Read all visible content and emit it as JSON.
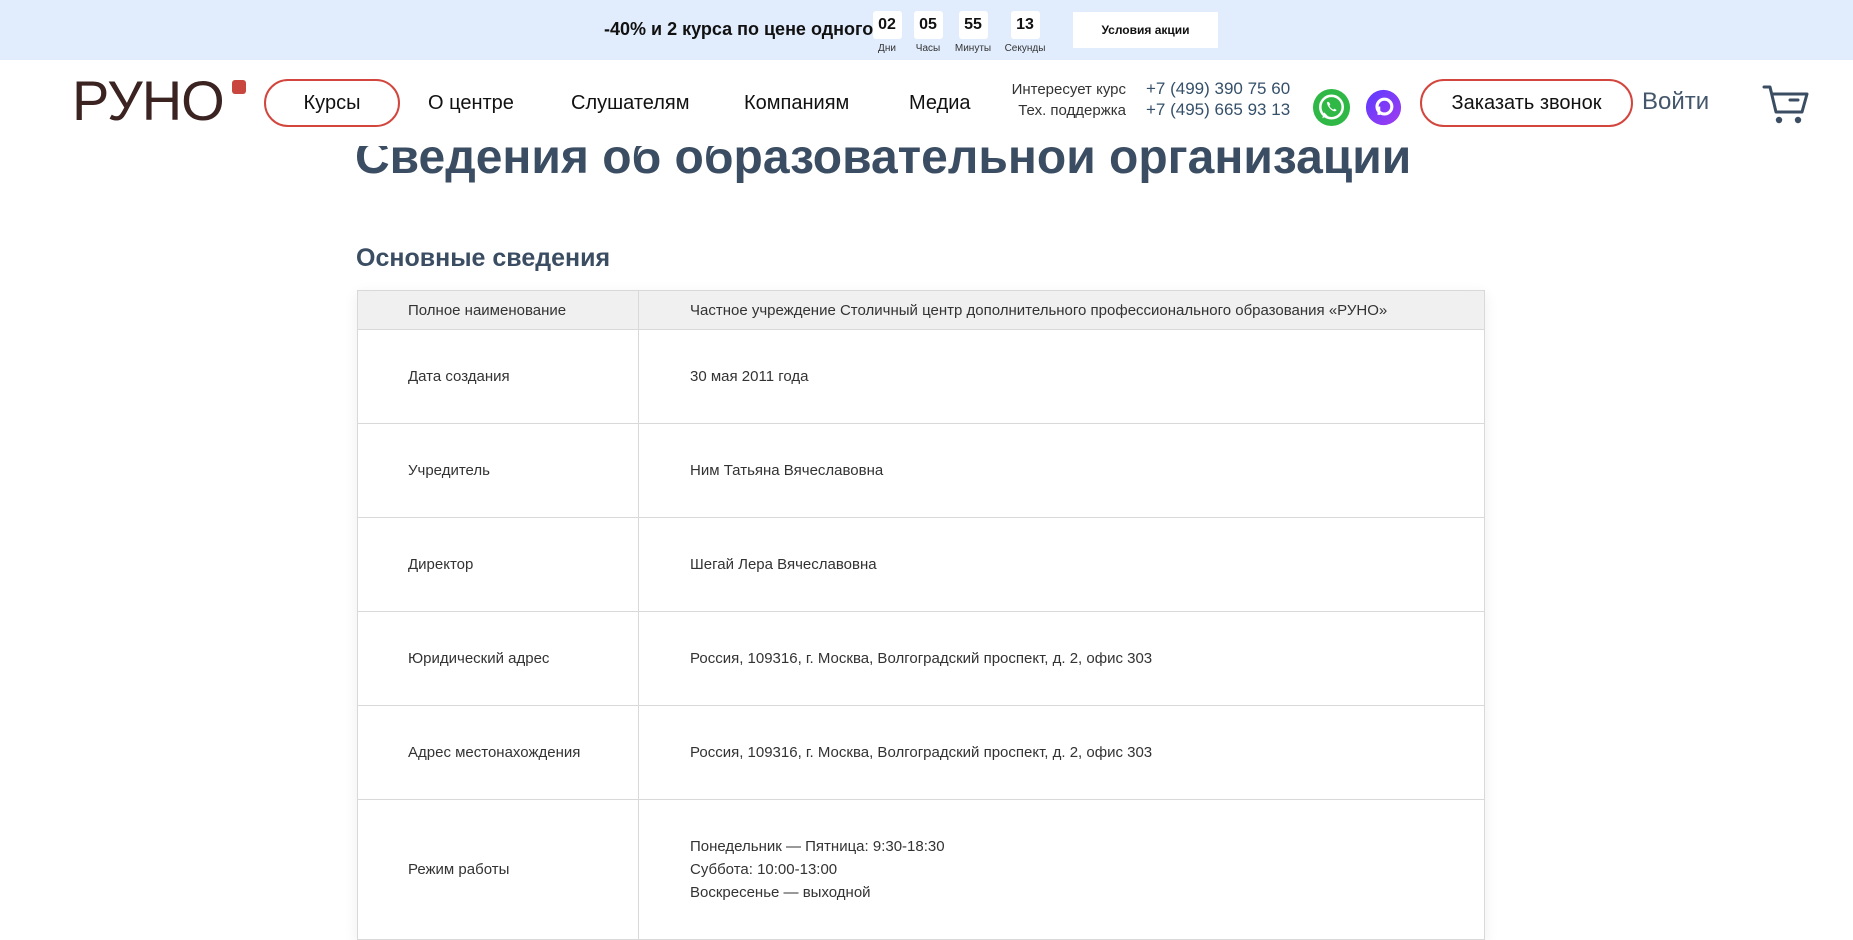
{
  "promo": {
    "text": "-40% и 2 курса по цене одного",
    "countdown": [
      {
        "value": "02",
        "label": "Дни"
      },
      {
        "value": "05",
        "label": "Часы"
      },
      {
        "value": "55",
        "label": "Минуты"
      },
      {
        "value": "13",
        "label": "Секунды"
      }
    ],
    "button_label": "Условия акции"
  },
  "header": {
    "logo": "РУНО",
    "nav": [
      "Курсы",
      "О центре",
      "Слушателям",
      "Компаниям",
      "Медиа"
    ],
    "contact_labels": [
      "Интересует курс",
      "Тех. поддержка"
    ],
    "phones": [
      "+7 (499) 390 75 60",
      "+7 (495) 665 93 13"
    ],
    "messengers": [
      "whatsapp-icon",
      "max-messenger-icon"
    ],
    "callback_label": "Заказать звонок",
    "login_label": "Войти",
    "cart_icon": "cart-icon"
  },
  "main": {
    "title": "Сведения об образовательной организации",
    "section_title": "Основные сведения",
    "rows": [
      {
        "label": "Полное наименование",
        "value": [
          "Частное учреждение Столичный центр дополнительного профессионального образования «РУНО»"
        ]
      },
      {
        "label": "Дата создания",
        "value": [
          "30 мая 2011 года"
        ]
      },
      {
        "label": "Учредитель",
        "value": [
          "Ним Татьяна Вячеславовна"
        ]
      },
      {
        "label": "Директор",
        "value": [
          "Шегай Лера Вячеславовна"
        ]
      },
      {
        "label": "Юридический адрес",
        "value": [
          "Россия, 109316, г. Москва, Волгоградский проспект, д. 2, офис 303"
        ]
      },
      {
        "label": "Адрес местонахождения",
        "value": [
          "Россия, 109316, г. Москва, Волгоградский проспект, д. 2, офис 303"
        ]
      },
      {
        "label": "Режим работы",
        "value": [
          "Понедельник — Пятница: 9:30-18:30",
          "Суббота: 10:00-13:00",
          "Воскресенье — выходной"
        ]
      }
    ]
  },
  "colors": {
    "promo_bg": "#e1edfd",
    "accent_red": "#d2463e",
    "heading": "#3b4d62",
    "phone": "#35506a",
    "whatsapp": "#2fb845",
    "max_messenger": "#8a2be2"
  }
}
